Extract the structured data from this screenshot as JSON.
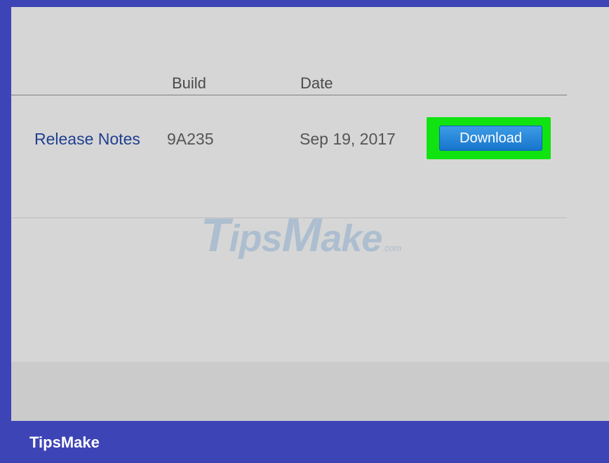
{
  "table": {
    "headers": {
      "build": "Build",
      "date": "Date"
    },
    "rows": [
      {
        "link": "Release Notes",
        "build": "9A235",
        "date": "Sep 19, 2017",
        "action": "Download"
      }
    ]
  },
  "watermark": {
    "main_first": "T",
    "main_rest_1": "ips",
    "main_second": "M",
    "main_rest_2": "ake",
    "suffix": ".com"
  },
  "footer": {
    "brand": "TipsMake"
  },
  "colors": {
    "frame": "#3d44b6",
    "highlight": "#10e310",
    "button": "#1f84d8",
    "link": "#1f3f8f"
  }
}
